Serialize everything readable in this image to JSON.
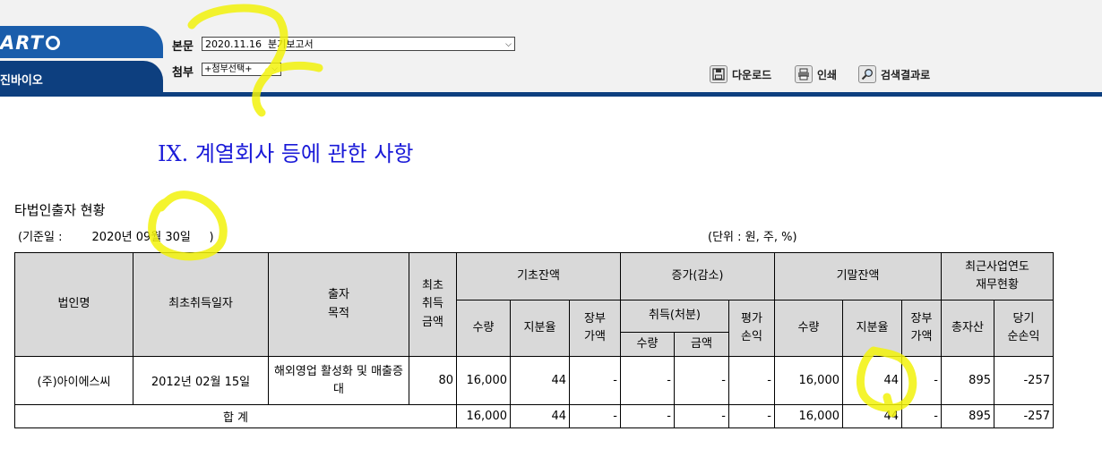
{
  "header": {
    "logo_text": "ART",
    "company_name": "진바이오",
    "report_label": "본문",
    "report_selected": "2020.11.16  분기보고서",
    "attach_label": "첨부",
    "attach_selected": "+첨부선택+",
    "download_label": "다운로드",
    "print_label": "인쇄",
    "search_results_label": "검색결과로",
    "download_icon": "save-icon",
    "print_icon": "printer-icon",
    "search_icon": "magnifier-icon"
  },
  "content": {
    "section_title": "IX. 계열회사 등에 관한 사항",
    "sub_title": "타법인출자 현황",
    "base_date": "(기준일 :        2020년 09월 30일     )",
    "unit_note": "(단위 : 원, 주, %)"
  },
  "table": {
    "headers": {
      "corp_name": "법인명",
      "first_acq_date": "최초취득일자",
      "purpose": "출자\n목적",
      "first_acq_amount": "최초\n취득\n금액",
      "begin_balance": "기초잔액",
      "change": "증가(감소)",
      "end_balance": "기말잔액",
      "recent_fin": "최근사업연도\n재무현황",
      "qty": "수량",
      "share_ratio": "지분율",
      "book_value": "장부\n가액",
      "acq_disp": "취득(처분)",
      "valuation_pl": "평가\n손익",
      "amount": "금액",
      "total_assets": "총자산",
      "net_income": "당기\n순손익"
    },
    "rows": [
      {
        "corp_name": "(주)아이에스씨",
        "first_acq_date": "2012년 02월 15일",
        "purpose": "해외영업 활성화 및 매출증대",
        "first_acq_amount": "80",
        "begin_qty": "16,000",
        "begin_ratio": "44",
        "begin_book": "-",
        "chg_qty": "-",
        "chg_amount": "-",
        "chg_valuation": "-",
        "end_qty": "16,000",
        "end_ratio": "44",
        "end_book": "-",
        "total_assets": "895",
        "net_income": "-257"
      }
    ],
    "total": {
      "label": "합 계",
      "begin_qty": "16,000",
      "begin_ratio": "44",
      "begin_book": "-",
      "chg_qty": "-",
      "chg_amount": "-",
      "chg_valuation": "-",
      "end_qty": "16,000",
      "end_ratio": "44",
      "end_book": "-",
      "total_assets": "895",
      "net_income": "-257"
    }
  },
  "colors": {
    "header_blue": "#1a5dab",
    "header_navy": "#0d3f7f",
    "title_blue": "#1a1ad8",
    "table_header_gray": "#d9d9d9",
    "highlighter_yellow": "#f2f20a"
  }
}
